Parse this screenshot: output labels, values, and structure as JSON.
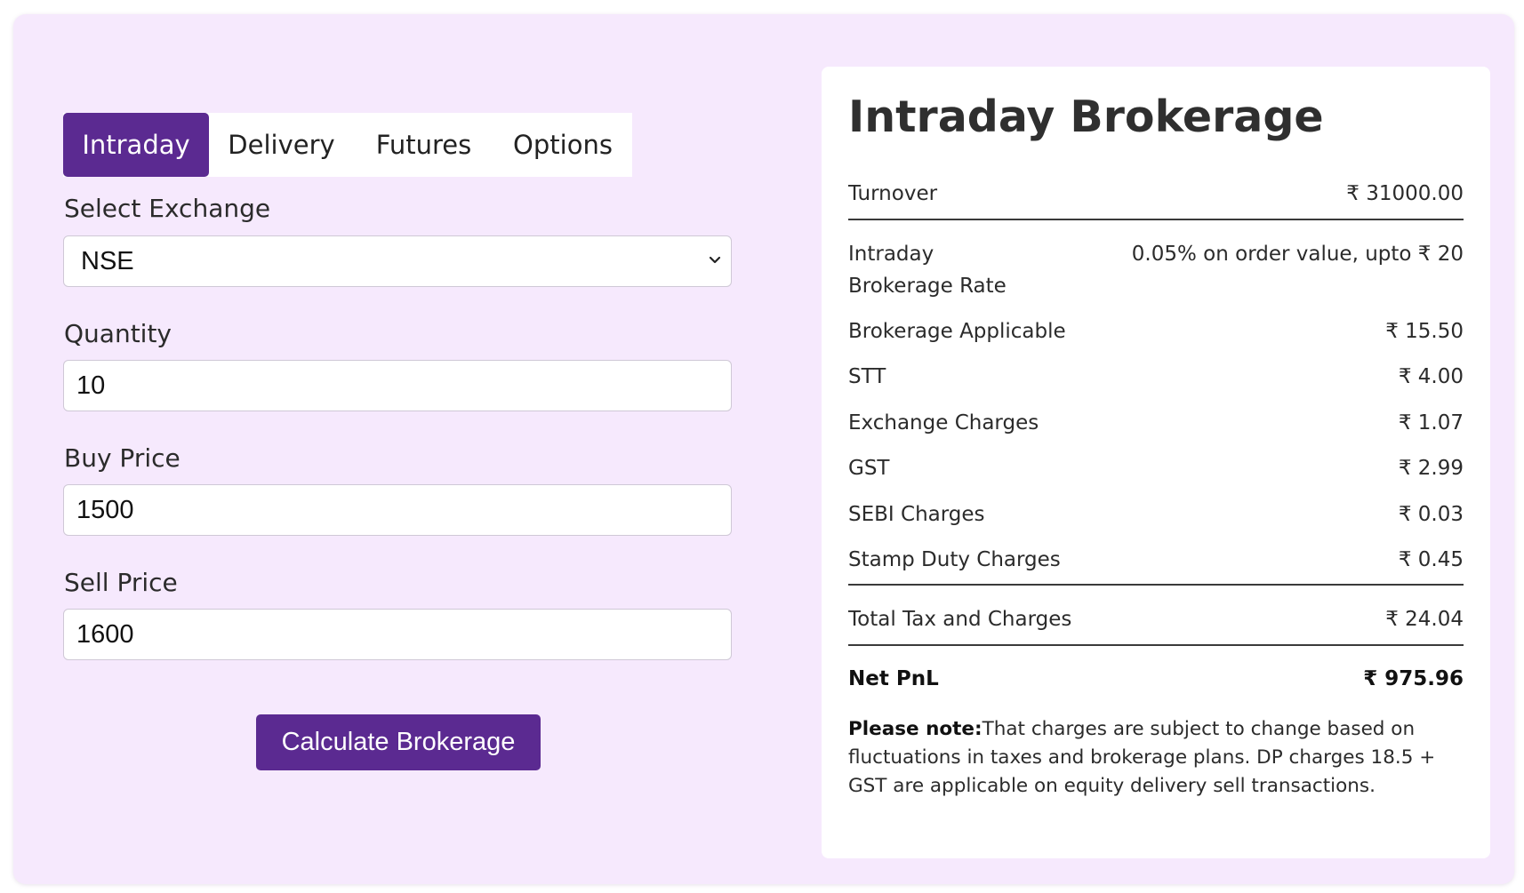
{
  "tabs": [
    {
      "label": "Intraday",
      "active": true
    },
    {
      "label": "Delivery",
      "active": false
    },
    {
      "label": "Futures",
      "active": false
    },
    {
      "label": "Options",
      "active": false
    }
  ],
  "form": {
    "exchange_label": "Select Exchange",
    "exchange_value": "NSE",
    "quantity_label": "Quantity",
    "quantity_value": "10",
    "buy_price_label": "Buy Price",
    "buy_price_value": "1500",
    "sell_price_label": "Sell Price",
    "sell_price_value": "1600",
    "submit_label": "Calculate Brokerage"
  },
  "result": {
    "title": "Intraday Brokerage",
    "turnover_label": "Turnover",
    "turnover_value": "₹ 31000.00",
    "rate_label": "Intraday Brokerage Rate",
    "rate_value": "0.05% on order value, upto ₹ 20",
    "brokerage_label": "Brokerage Applicable",
    "brokerage_value": "₹ 15.50",
    "stt_label": "STT",
    "stt_value": "₹ 4.00",
    "exchange_charges_label": "Exchange Charges",
    "exchange_charges_value": "₹ 1.07",
    "gst_label": "GST",
    "gst_value": "₹ 2.99",
    "sebi_label": "SEBI Charges",
    "sebi_value": "₹ 0.03",
    "stamp_label": "Stamp Duty Charges",
    "stamp_value": "₹ 0.45",
    "total_label": "Total Tax and Charges",
    "total_value": "₹ 24.04",
    "net_label": "Net PnL",
    "net_value": "₹ 975.96",
    "note_prefix": "Please note:",
    "note_text": "That charges are subject to change based on fluctuations in taxes and brokerage plans. DP charges 18.5 + GST are applicable on equity delivery sell transactions."
  },
  "colors": {
    "accent": "#5b2a91",
    "page_background": "#f6e9fd",
    "card_background": "#ffffff"
  }
}
